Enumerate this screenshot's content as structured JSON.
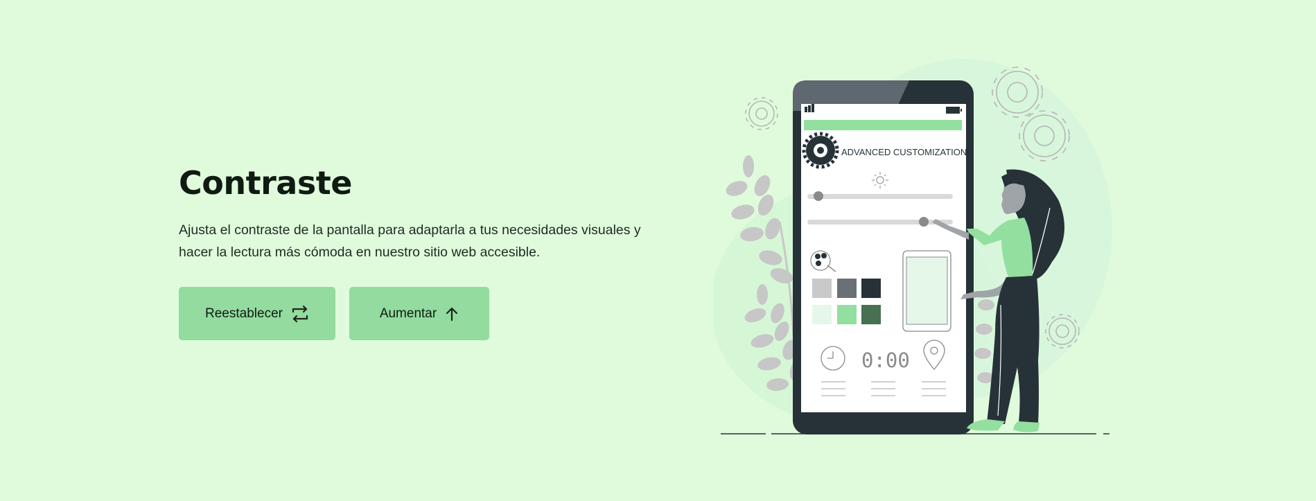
{
  "hero": {
    "title": "Contraste",
    "description": "Ajusta el contraste de la pantalla para adaptarla a tus necesidades visuales y hacer la lectura más cómoda en nuestro sitio web accesible."
  },
  "buttons": {
    "reset_label": "Reestablecer",
    "increase_label": "Aumentar"
  },
  "illustration": {
    "app_title": "ADVANCED CUSTOMIZATION",
    "timer": "0:00"
  },
  "colors": {
    "background": "#e0fbdc",
    "accent": "#93db9f",
    "dark": "#263238"
  },
  "icons": {
    "reset": "swap-arrows-icon",
    "increase": "arrow-up-icon"
  }
}
